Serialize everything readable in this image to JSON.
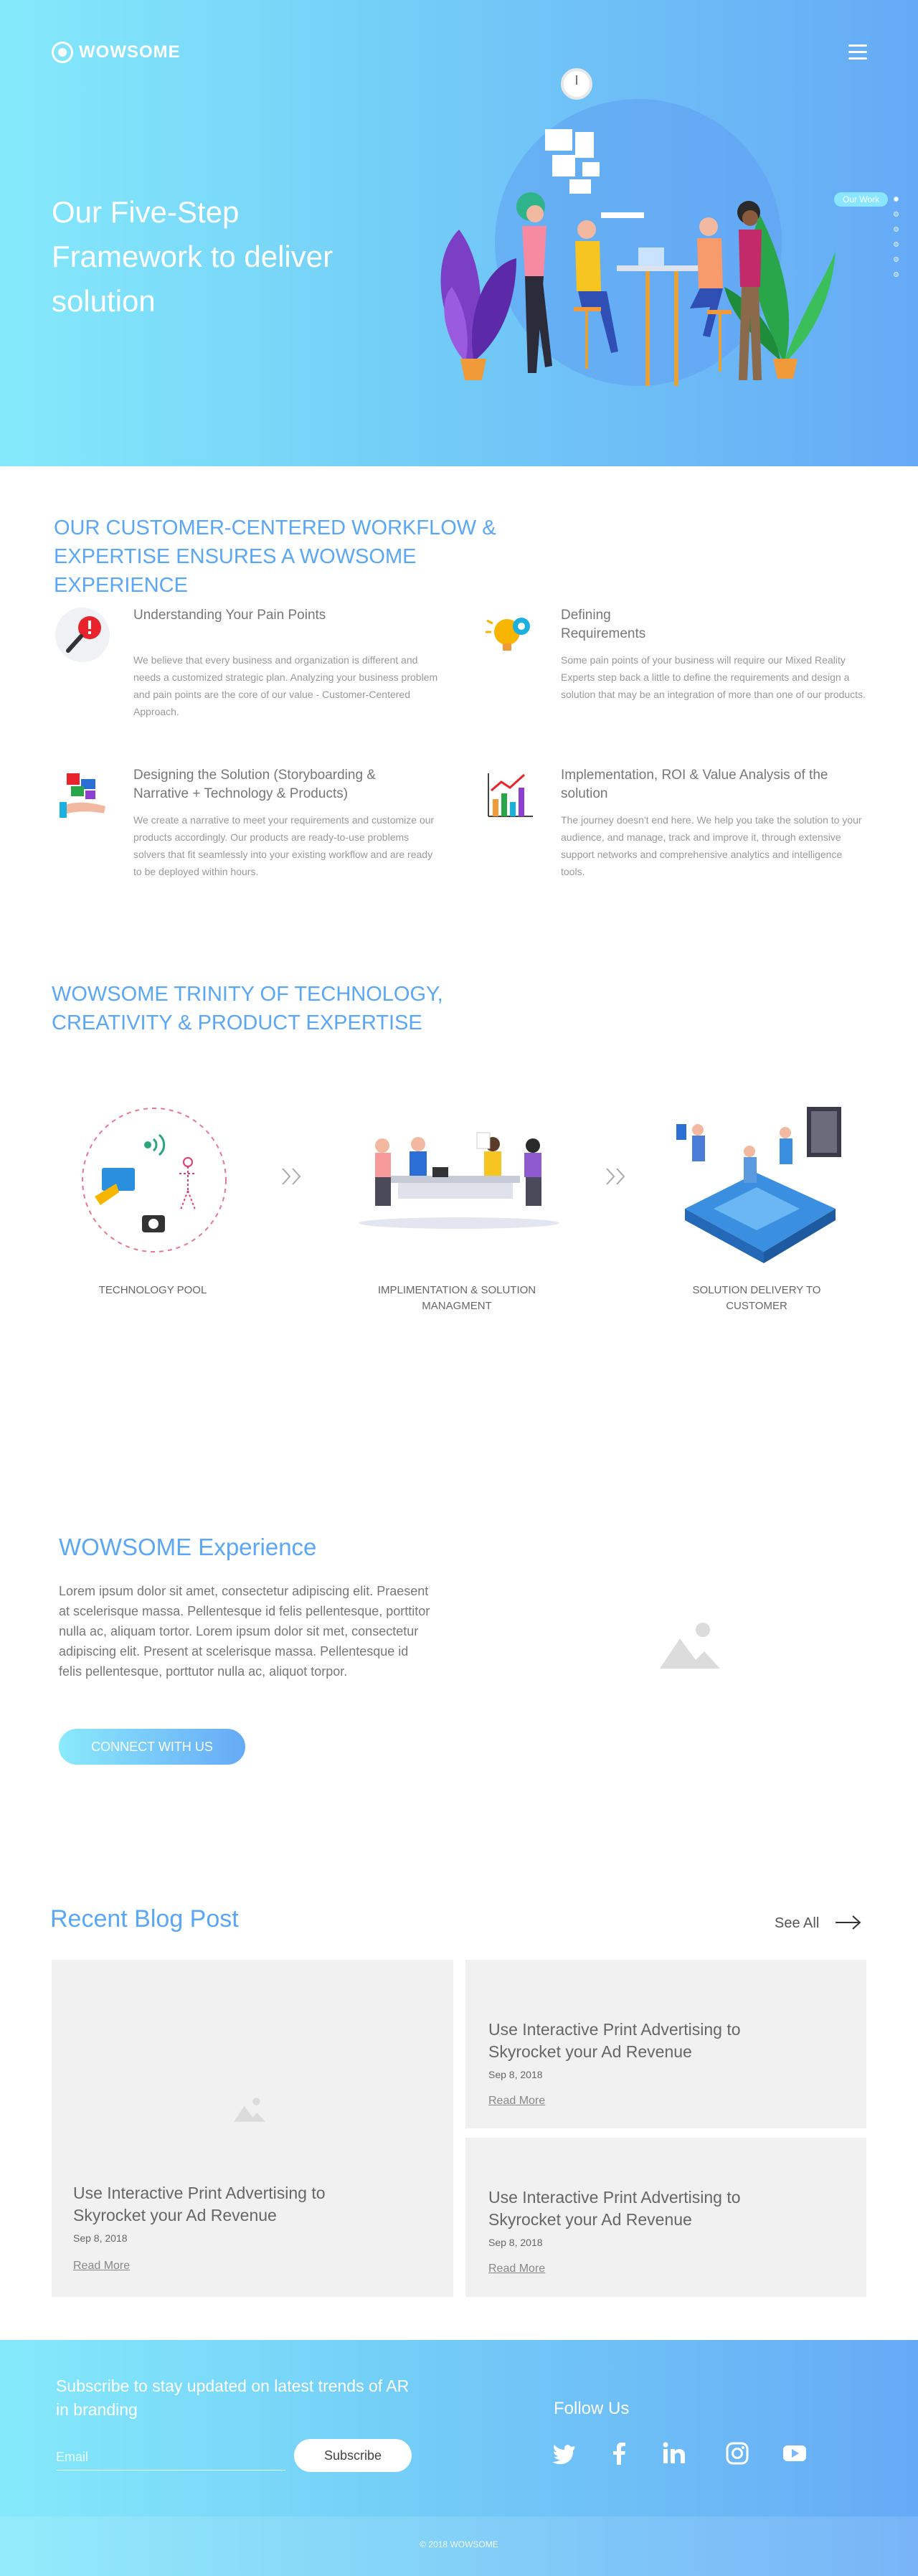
{
  "brand": {
    "name": "WOWSOME"
  },
  "hero": {
    "title": "Our Five-Step Framework to deliver solution",
    "our_work_label": "Our Work",
    "slide_count": 6,
    "active_slide": 1
  },
  "workflow": {
    "title": "OUR CUSTOMER-CENTERED WORKFLOW & EXPERTISE ENSURES A WOWSOME EXPERIENCE",
    "items": [
      {
        "title": "Understanding Your Pain Points",
        "text": "We believe that every business and organization is different and needs a customized strategic plan. Analyzing your business problem and pain points are the core of our value - Customer-Centered Approach.",
        "icon": "magnifier-alert-icon"
      },
      {
        "title": "Defining Requirements",
        "text": "Some pain points of your business will require our Mixed Reality Experts step back a little to define the requirements and design a solution that may be an integration of more than one of our products.",
        "icon": "lightbulb-gear-icon"
      },
      {
        "title": "Designing the Solution (Storyboarding & Narrative + Technology & Products)",
        "text": "We create a narrative to meet your requirements and customize our products accordingly. Our products are ready-to-use problems solvers that fit seamlessly into your existing workflow and are ready to be deployed within hours.",
        "icon": "puzzle-hand-icon"
      },
      {
        "title": "Implementation, ROI & Value Analysis of the solution",
        "text": "The journey doesn't end here. We help you take the solution to your audience, and manage, track and improve it, through extensive support networks and comprehensive analytics and intelligence tools.",
        "icon": "bar-chart-icon"
      }
    ]
  },
  "trinity": {
    "title": "WOWSOME TRINITY OF TECHNOLOGY, CREATIVITY & PRODUCT EXPERTISE",
    "steps": [
      {
        "label": "TECHNOLOGY POOL"
      },
      {
        "label": "IMPLIMENTATION & SOLUTION MANAGMENT"
      },
      {
        "label": "SOLUTION DELIVERY TO CUSTOMER"
      }
    ]
  },
  "experience": {
    "title": "WOWSOME Experience",
    "text": "Lorem ipsum dolor sit amet, consectetur adipiscing elit. Praesent at scelerisque massa. Pellentesque id felis pellentesque, porttitor nulla ac, aliquam tortor. Lorem ipsum dolor sit met, consectetur adipiscing elit. Present at scelerisque massa. Pellentesque id felis pellentesque, porttutor nulla ac, aliquot torpor.",
    "button_label": "CONNECT WITH US"
  },
  "blog": {
    "title": "Recent Blog Post",
    "see_all": "See All",
    "posts": [
      {
        "title": "Use Interactive Print Advertising to Skyrocket your Ad Revenue",
        "date": "Sep 8, 2018",
        "read_more": "Read More"
      },
      {
        "title": "Use Interactive Print Advertising to Skyrocket your Ad Revenue",
        "date": "Sep 8, 2018",
        "read_more": "Read More"
      },
      {
        "title": "Use Interactive Print Advertising to Skyrocket your Ad Revenue",
        "date": "Sep 8, 2018",
        "read_more": "Read More"
      }
    ]
  },
  "footer": {
    "subscribe_text": "Subscribe to stay updated on latest trends of AR in branding",
    "email_placeholder": "Email",
    "subscribe_button": "Subscribe",
    "follow_title": "Follow Us",
    "social": [
      "twitter-icon",
      "facebook-icon",
      "linkedin-icon",
      "instagram-icon",
      "youtube-icon"
    ],
    "copyright": "© 2018 WOWSOME"
  },
  "colors": {
    "accent": "#59a7f6",
    "gradient_start": "#85e9fb",
    "gradient_end": "#66aaf6"
  }
}
